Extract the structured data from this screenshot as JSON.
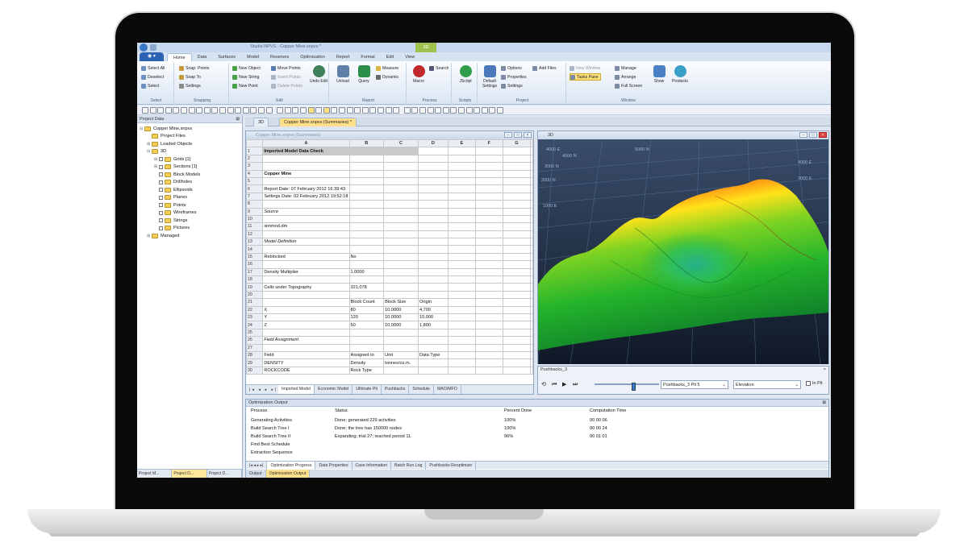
{
  "app": {
    "title": "Studio NPVS - Copper Mine.snpvs *",
    "context_tab": "3D"
  },
  "menu": {
    "file_label": "",
    "tabs": [
      "Home",
      "Data",
      "Surfaces",
      "Model",
      "Reserves",
      "Optimization",
      "Report",
      "Format",
      "Edit",
      "View"
    ],
    "active": "Home"
  },
  "ribbon": {
    "select": {
      "label": "Select",
      "items": [
        "Select All",
        "Deselect",
        "Select"
      ]
    },
    "snapping": {
      "label": "Snapping",
      "items": [
        "Snap: Points",
        "Snap To",
        "Settings"
      ]
    },
    "edit": {
      "label": "Edit",
      "items": [
        "New Object",
        "New String",
        "New Point",
        "Move Points",
        "Insert Points",
        "Delete Points"
      ],
      "undo": "Undo Edit"
    },
    "report": {
      "label": "Report",
      "big": [
        "Unload",
        "Query"
      ],
      "items": [
        "Measure",
        "Dynamic"
      ]
    },
    "process": {
      "label": "Process",
      "big": [
        "Macro"
      ],
      "items": [
        "Search"
      ]
    },
    "scripts": {
      "label": "Scripts",
      "big": [
        "JScript"
      ]
    },
    "project": {
      "label": "Project",
      "big": [
        "Default Settings"
      ],
      "items": [
        "Options",
        "Properties",
        "Settings",
        "Add Files"
      ]
    },
    "window": {
      "label": "Window",
      "items": [
        "New Window",
        "Tasks Pane",
        "Manage",
        "Arrange",
        "Full Screen"
      ],
      "big": [
        "Show",
        "Products"
      ]
    }
  },
  "left_pane": {
    "title": "Project Data",
    "tree": [
      {
        "label": "Copper Mine.snpvs",
        "level": 0,
        "exp": "⊟"
      },
      {
        "label": "Project Files",
        "level": 1,
        "exp": ""
      },
      {
        "label": "Loaded Objects",
        "level": 1,
        "exp": "⊞"
      },
      {
        "label": "3D",
        "level": 1,
        "exp": "⊟"
      },
      {
        "label": "Grids [1]",
        "level": 2,
        "exp": "⊞"
      },
      {
        "label": "Sections [1]",
        "level": 2,
        "exp": "⊞"
      },
      {
        "label": "Block Models",
        "level": 2,
        "exp": ""
      },
      {
        "label": "Drillholes",
        "level": 2,
        "exp": ""
      },
      {
        "label": "Ellipsoids",
        "level": 2,
        "exp": ""
      },
      {
        "label": "Planes",
        "level": 2,
        "exp": ""
      },
      {
        "label": "Points",
        "level": 2,
        "exp": ""
      },
      {
        "label": "Wireframes",
        "level": 2,
        "exp": ""
      },
      {
        "label": "Strings",
        "level": 2,
        "exp": ""
      },
      {
        "label": "Pictures",
        "level": 2,
        "exp": ""
      },
      {
        "label": "Managed",
        "level": 1,
        "exp": "⊞"
      }
    ],
    "bottom_tabs": [
      "Project M...",
      "Project D...",
      "Project D..."
    ]
  },
  "doc_tabs": [
    "3D",
    "Copper Mine.snpvs (Summaries) *"
  ],
  "sheet": {
    "title": "Copper Mine.snpvs (Summaries)",
    "columns": [
      "A",
      "B",
      "C",
      "D",
      "E",
      "F",
      "G"
    ],
    "rows": [
      {
        "n": "1",
        "cells": [
          "Imported Model Data Check",
          "",
          "",
          "",
          "",
          "",
          ""
        ],
        "style": "hl"
      },
      {
        "n": "2",
        "cells": [
          "",
          "",
          "",
          "",
          "",
          "",
          ""
        ]
      },
      {
        "n": "3",
        "cells": [
          "",
          "",
          "",
          "",
          "",
          "",
          ""
        ]
      },
      {
        "n": "4",
        "cells": [
          "Copper Mine",
          "",
          "",
          "",
          "",
          "",
          ""
        ],
        "style": "b"
      },
      {
        "n": "5",
        "cells": [
          "",
          "",
          "",
          "",
          "",
          "",
          ""
        ]
      },
      {
        "n": "6",
        "cells": [
          "Report Date:  07 February 2012 16:39:43",
          "",
          "",
          "",
          "",
          "",
          ""
        ]
      },
      {
        "n": "7",
        "cells": [
          "Settings Date: 02 February 2012 19:52:18",
          "",
          "",
          "",
          "",
          "",
          ""
        ]
      },
      {
        "n": "8",
        "cells": [
          "",
          "",
          "",
          "",
          "",
          "",
          ""
        ]
      },
      {
        "n": "9",
        "cells": [
          "Source",
          "",
          "",
          "",
          "",
          "",
          ""
        ],
        "style": "i"
      },
      {
        "n": "10",
        "cells": [
          "",
          "",
          "",
          "",
          "",
          "",
          ""
        ]
      },
      {
        "n": "11",
        "cells": [
          "simmod.dm",
          "",
          "",
          "",
          "",
          "",
          ""
        ]
      },
      {
        "n": "12",
        "cells": [
          "",
          "",
          "",
          "",
          "",
          "",
          ""
        ]
      },
      {
        "n": "13",
        "cells": [
          "Model Definition",
          "",
          "",
          "",
          "",
          "",
          ""
        ],
        "style": "i"
      },
      {
        "n": "14",
        "cells": [
          "",
          "",
          "",
          "",
          "",
          "",
          ""
        ]
      },
      {
        "n": "15",
        "cells": [
          "Reblocked",
          "No",
          "",
          "",
          "",
          "",
          ""
        ]
      },
      {
        "n": "16",
        "cells": [
          "",
          "",
          "",
          "",
          "",
          "",
          ""
        ]
      },
      {
        "n": "17",
        "cells": [
          "Density Multiplier",
          "1.0000",
          "",
          "",
          "",
          "",
          ""
        ]
      },
      {
        "n": "18",
        "cells": [
          "",
          "",
          "",
          "",
          "",
          "",
          ""
        ]
      },
      {
        "n": "19",
        "cells": [
          "Cells under Topography",
          "321,078",
          "",
          "",
          "",
          "",
          ""
        ]
      },
      {
        "n": "20",
        "cells": [
          "",
          "",
          "",
          "",
          "",
          "",
          ""
        ]
      },
      {
        "n": "21",
        "cells": [
          "",
          "Block Count",
          "Block Size",
          "Origin",
          "",
          "",
          ""
        ]
      },
      {
        "n": "22",
        "cells": [
          "X",
          "80",
          "10.0000",
          "4,700",
          "",
          "",
          ""
        ]
      },
      {
        "n": "23",
        "cells": [
          "Y",
          "120",
          "10.0000",
          "10,000",
          "",
          "",
          ""
        ]
      },
      {
        "n": "24",
        "cells": [
          "Z",
          "50",
          "10.0000",
          "1,800",
          "",
          "",
          ""
        ]
      },
      {
        "n": "25",
        "cells": [
          "",
          "",
          "",
          "",
          "",
          "",
          ""
        ]
      },
      {
        "n": "26",
        "cells": [
          "Field Assignment",
          "",
          "",
          "",
          "",
          "",
          ""
        ],
        "style": "i"
      },
      {
        "n": "27",
        "cells": [
          "",
          "",
          "",
          "",
          "",
          "",
          ""
        ]
      },
      {
        "n": "28",
        "cells": [
          "Field",
          "Assigned to",
          "Unit",
          "Data Type",
          "",
          "",
          ""
        ]
      },
      {
        "n": "29",
        "cells": [
          "DENSITY",
          "Density",
          "tonnes/cu.m.",
          "",
          "",
          "",
          ""
        ]
      },
      {
        "n": "30",
        "cells": [
          "ROCKCODE",
          "Rock Type",
          "",
          "",
          "",
          "",
          ""
        ]
      }
    ],
    "tabs": [
      "Imported Model",
      "Economic Model",
      "Ultimate Pit",
      "Pushbacks",
      "Schedule",
      "MAO/MFO"
    ],
    "active_tab": "Imported Model"
  },
  "view3d": {
    "title": "3D",
    "axis_labels": [
      "4000 E",
      "4000 N",
      "3000 N",
      "2000 N",
      "1000 E",
      "5000 N",
      "4000 E",
      "3000 E"
    ]
  },
  "pushbacks": {
    "title": "Pushbacks_3",
    "select1": "Pushbacks_3 Pit 5",
    "select2": "Elevation",
    "check_label": "In Pit",
    "slider_value": 0.6
  },
  "optimization": {
    "title": "Optimization Output",
    "headers": [
      "Process",
      "Status",
      "Percent Done",
      "Computation Time"
    ],
    "rows": [
      [
        "Generating Activities",
        "Done; generated 229 activities",
        "100%",
        "00 00 06"
      ],
      [
        "Build Search Tree I",
        "Done; the tree has 150000 nodes",
        "100%",
        "00 00 24"
      ],
      [
        "Build Search Tree II",
        "Expanding; trial 27; reached period 11.",
        "96%",
        "00 01 01"
      ],
      [
        "Find Best Schedule",
        "",
        "",
        ""
      ],
      [
        "Extraction Sequence",
        "",
        "",
        ""
      ]
    ],
    "tabs": [
      "Optimization Progress",
      "Data Properties",
      "Case Information",
      "Batch Run Log",
      "Pushbacks Reoptimize"
    ],
    "active_tab": "Optimization Progress",
    "output_tabs": [
      "Output",
      "Optimization Output"
    ],
    "active_output": "Optimization Output"
  }
}
